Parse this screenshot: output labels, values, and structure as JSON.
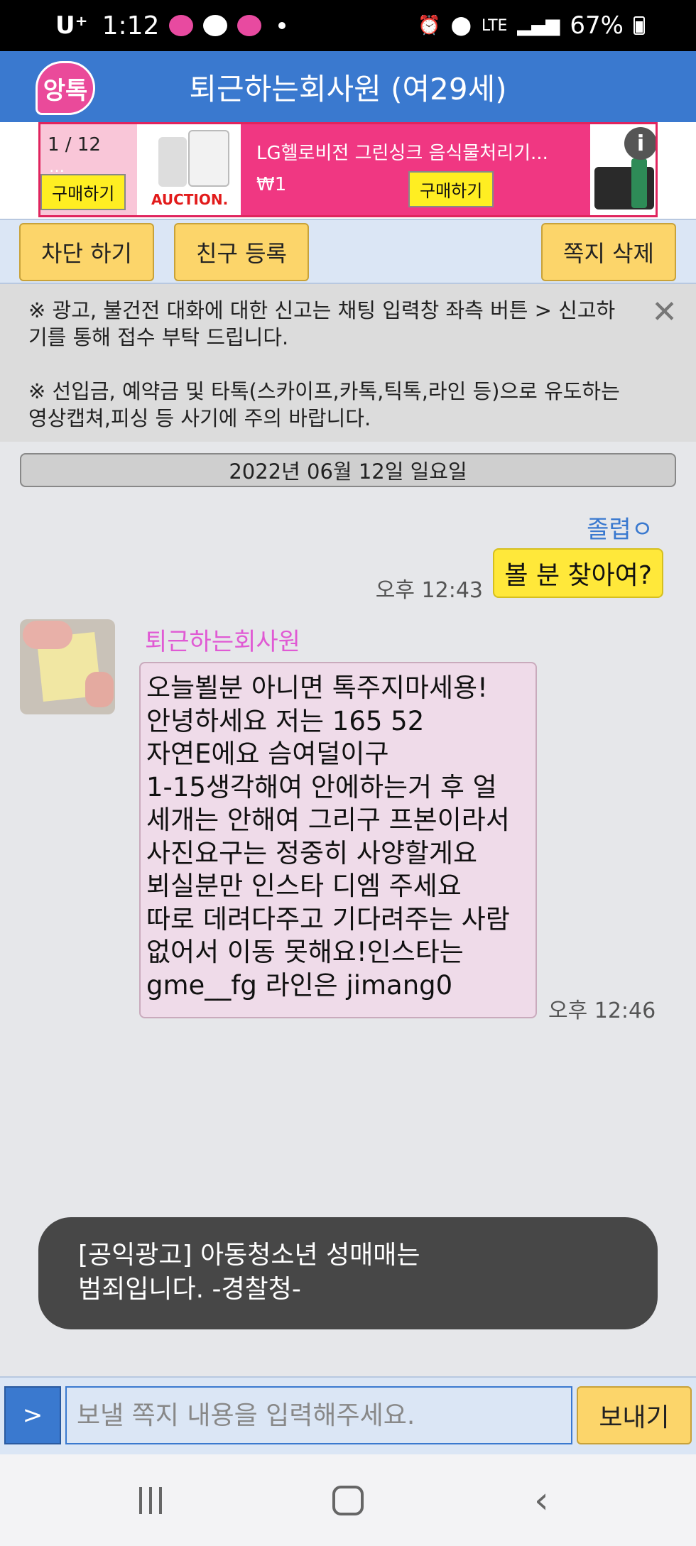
{
  "status_bar": {
    "carrier": "U⁺",
    "time": "1:12",
    "network": "LTE",
    "battery": "67%"
  },
  "header": {
    "logo_text": "앙톡",
    "title": "퇴근하는회사원 (여29세)"
  },
  "ad": {
    "counter": "1 / 12",
    "partial_text": "…",
    "buy_label": "구매하기",
    "buy_partial_label": "구매하기",
    "auction_logo": "AUCTION.",
    "product_title": "LG헬로비전 그린싱크 음식물처리기...",
    "price": "₩1",
    "info_icon": "i"
  },
  "toolbar": {
    "block_label": "차단 하기",
    "friend_label": "친구 등록",
    "delete_label": "쪽지 삭제"
  },
  "notice": {
    "line1": "※ 광고, 불건전 대화에 대한 신고는 채팅 입력창 좌측 버튼 > 신고하기를 통해 접수 부탁 드립니다.",
    "line2": "※ 선입금, 예약금 및 타톡(스카이프,카톡,틱톡,라인 등)으로 유도하는 영상캡쳐,피싱 등 사기에 주의 바랍니다.",
    "close_icon": "✕"
  },
  "chat": {
    "date": "2022년 06월 12일 일요일",
    "my_name": "졸렵ㅇ",
    "my_message": "볼 분 찾아여?",
    "my_time": "오후 12:43",
    "other_name": "퇴근하는회사원",
    "other_lines": [
      "오늘뵐분 아니면 톡주지마세용!",
      "안녕하세요 저는 165 52",
      "자연E에요 슴여덜이구",
      "1-15생각해여 안에하는거 후 얼",
      "세개는 안해여 그리구 프본이라서",
      "사진요구는 정중히 사양할게요",
      "뵈실분만 인스타 디엠 주세요",
      "따로 데려다주고 기다려주는 사람",
      "없어서 이동 못해요!인스타는",
      "gme__fg 라인은 jimang0"
    ],
    "other_time": "오후 12:46"
  },
  "psa": {
    "line1": "[공익광고] 아동청소년 성매매는",
    "line2": "범죄입니다. -경찰청-"
  },
  "composer": {
    "expand_label": ">",
    "placeholder": "보낼 쪽지 내용을 입력해주세요.",
    "send_label": "보내기"
  },
  "colors": {
    "header_blue": "#3a79cf",
    "button_yellow": "#fcd56a",
    "my_bubble": "#ffe83a",
    "other_bubble": "#efdbe9",
    "other_name": "#e05ad4",
    "ad_pink": "#f03782"
  }
}
